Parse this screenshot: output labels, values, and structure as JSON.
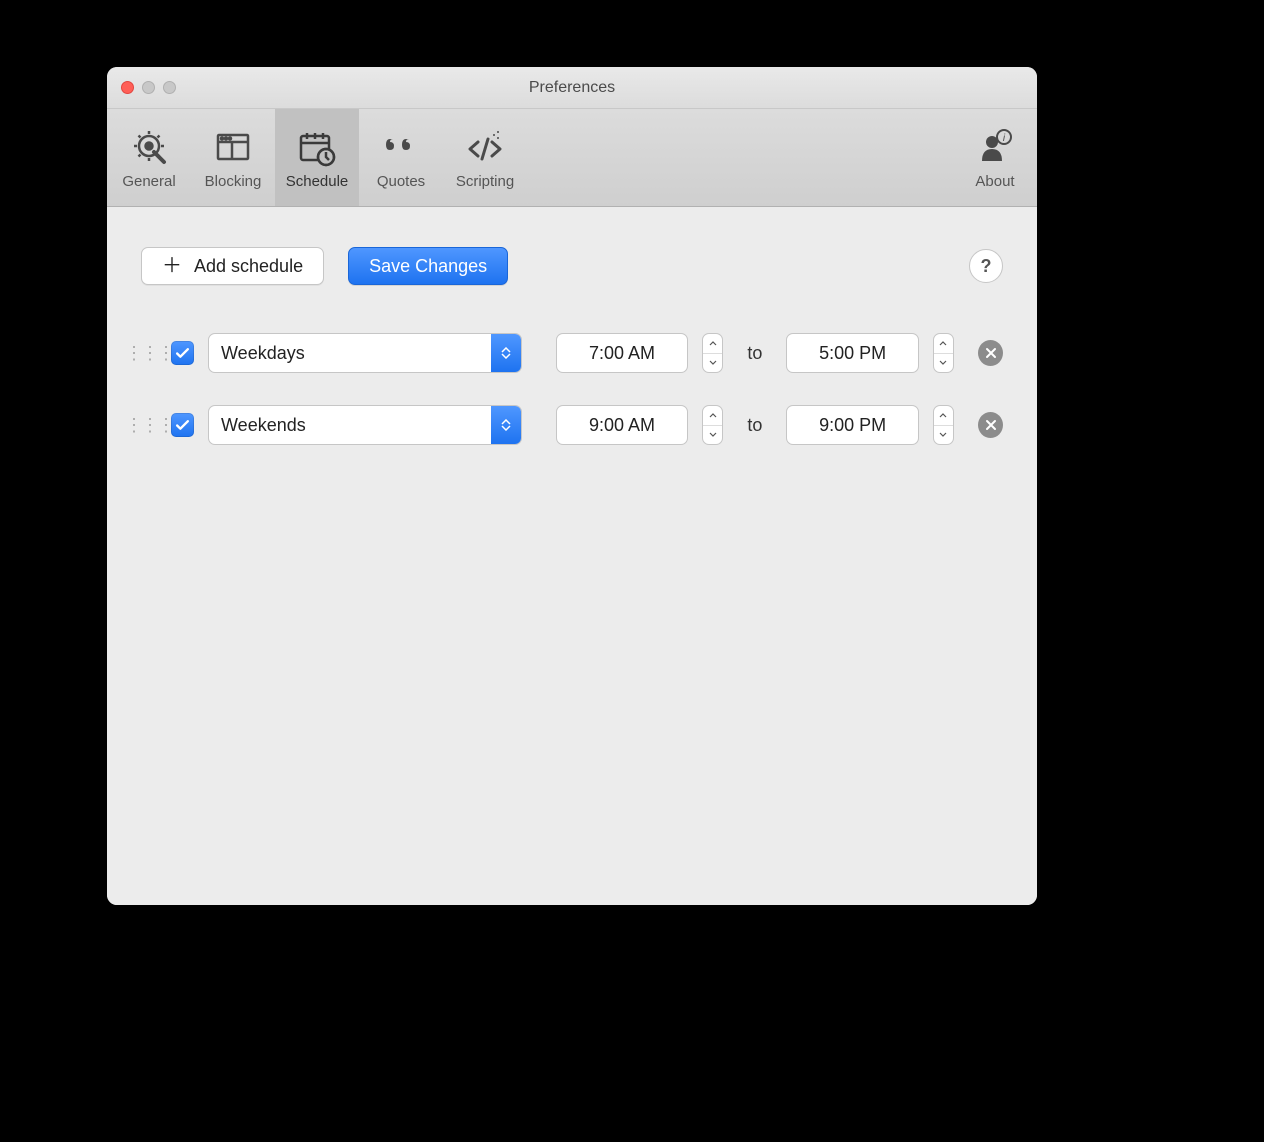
{
  "window": {
    "title": "Preferences"
  },
  "toolbar": {
    "items": [
      {
        "label": "General",
        "icon": "gear-icon"
      },
      {
        "label": "Blocking",
        "icon": "layout-icon"
      },
      {
        "label": "Schedule",
        "icon": "calendar-icon",
        "active": true
      },
      {
        "label": "Quotes",
        "icon": "quotes-icon"
      },
      {
        "label": "Scripting",
        "icon": "code-icon"
      }
    ],
    "about": {
      "label": "About",
      "icon": "about-icon"
    }
  },
  "buttons": {
    "add_schedule": "Add schedule",
    "save_changes": "Save Changes",
    "help": "?"
  },
  "schedule": {
    "to_label": "to",
    "rows": [
      {
        "enabled": true,
        "period": "Weekdays",
        "start": "7:00 AM",
        "end": "5:00 PM"
      },
      {
        "enabled": true,
        "period": "Weekends",
        "start": "9:00 AM",
        "end": "9:00 PM"
      }
    ]
  }
}
